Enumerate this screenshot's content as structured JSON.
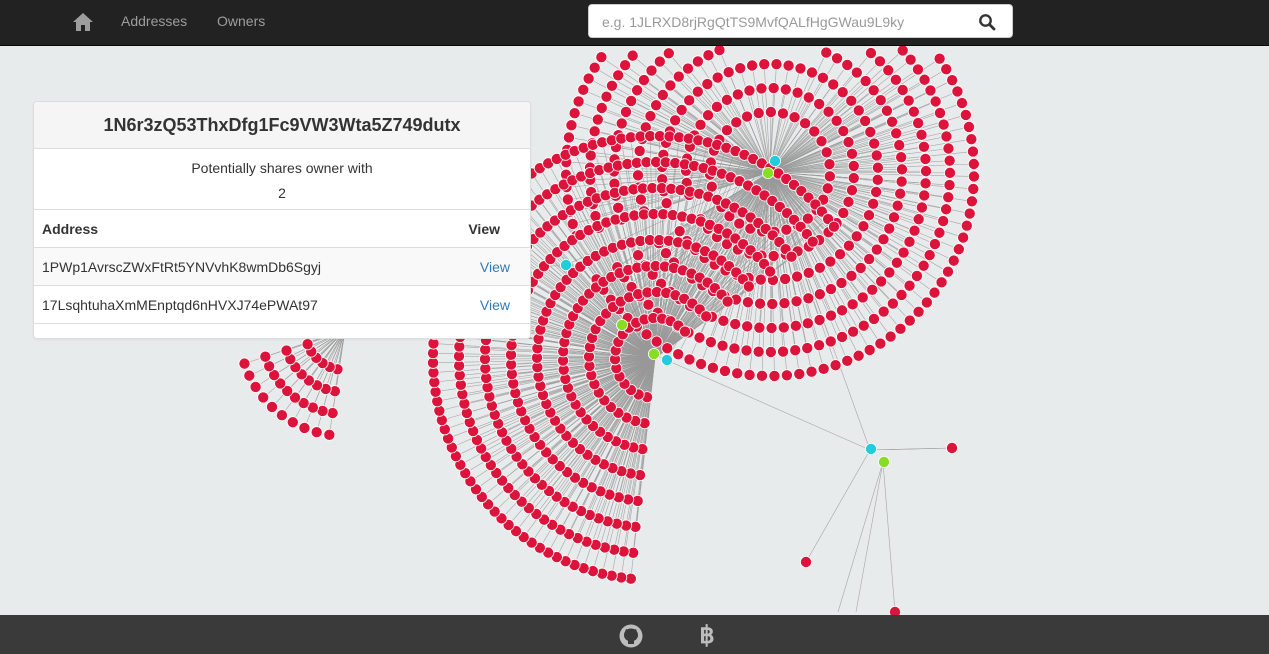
{
  "nav": {
    "links": [
      "Addresses",
      "Owners"
    ],
    "search_placeholder": "e.g. 1JLRXD8rjRgQtTS9MvfQALfHgGWau9L9ky"
  },
  "panel": {
    "title": "1N6r3zQ53ThxDfg1Fc9VW3Wta5Z749dutx",
    "shares_text": "Potentially shares owner with",
    "count": "2",
    "table": {
      "headers": [
        "Address",
        "View"
      ],
      "rows": [
        {
          "address": "1PWp1AvrscZWxFtRt5YNVvhK8wmDb6Sgyj",
          "view": "View"
        },
        {
          "address": "17LsqhtuhaXmMEnptqd6nHVXJ74ePWAt97",
          "view": "View"
        }
      ]
    }
  },
  "colors": {
    "address_node": "#dc143c",
    "hub_node_cyan": "#22ccdd",
    "hub_node_green": "#88dd22",
    "edge": "#999999",
    "navbar": "#222222",
    "footer": "#3a3a3a"
  },
  "icons": [
    "home-icon",
    "search-icon",
    "github-icon",
    "bitcoin-icon"
  ]
}
